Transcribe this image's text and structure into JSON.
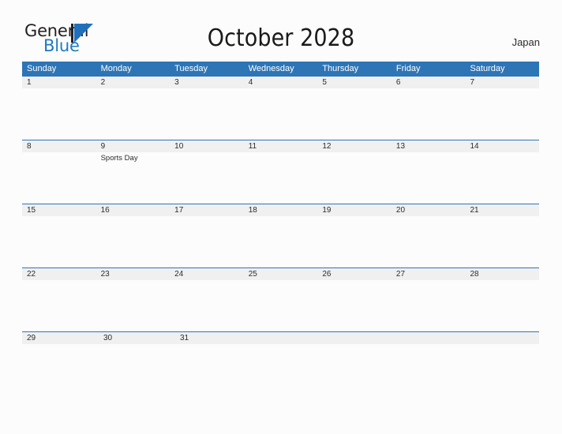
{
  "logo": {
    "word_one": "General",
    "word_two": "Blue",
    "mark": "triangle-flag-icon"
  },
  "header": {
    "title": "October 2028",
    "country": "Japan"
  },
  "calendar": {
    "weekdays": [
      "Sunday",
      "Monday",
      "Tuesday",
      "Wednesday",
      "Thursday",
      "Friday",
      "Saturday"
    ],
    "weeks": [
      {
        "days": [
          {
            "number": "1",
            "event": ""
          },
          {
            "number": "2",
            "event": ""
          },
          {
            "number": "3",
            "event": ""
          },
          {
            "number": "4",
            "event": ""
          },
          {
            "number": "5",
            "event": ""
          },
          {
            "number": "6",
            "event": ""
          },
          {
            "number": "7",
            "event": ""
          }
        ]
      },
      {
        "days": [
          {
            "number": "8",
            "event": ""
          },
          {
            "number": "9",
            "event": "Sports Day"
          },
          {
            "number": "10",
            "event": ""
          },
          {
            "number": "11",
            "event": ""
          },
          {
            "number": "12",
            "event": ""
          },
          {
            "number": "13",
            "event": ""
          },
          {
            "number": "14",
            "event": ""
          }
        ]
      },
      {
        "days": [
          {
            "number": "15",
            "event": ""
          },
          {
            "number": "16",
            "event": ""
          },
          {
            "number": "17",
            "event": ""
          },
          {
            "number": "18",
            "event": ""
          },
          {
            "number": "19",
            "event": ""
          },
          {
            "number": "20",
            "event": ""
          },
          {
            "number": "21",
            "event": ""
          }
        ]
      },
      {
        "days": [
          {
            "number": "22",
            "event": ""
          },
          {
            "number": "23",
            "event": ""
          },
          {
            "number": "24",
            "event": ""
          },
          {
            "number": "25",
            "event": ""
          },
          {
            "number": "26",
            "event": ""
          },
          {
            "number": "27",
            "event": ""
          },
          {
            "number": "28",
            "event": ""
          }
        ]
      },
      {
        "days": [
          {
            "number": "29",
            "event": ""
          },
          {
            "number": "30",
            "event": ""
          },
          {
            "number": "31",
            "event": ""
          },
          {
            "number": "",
            "event": ""
          },
          {
            "number": "",
            "event": ""
          },
          {
            "number": "",
            "event": ""
          },
          {
            "number": "",
            "event": ""
          }
        ]
      }
    ]
  },
  "colors": {
    "header_blue": "#2e75b6",
    "band_gray": "#f0f0f0",
    "logo_blue": "#1f6fbb",
    "page_background": "#fcfcfd"
  }
}
